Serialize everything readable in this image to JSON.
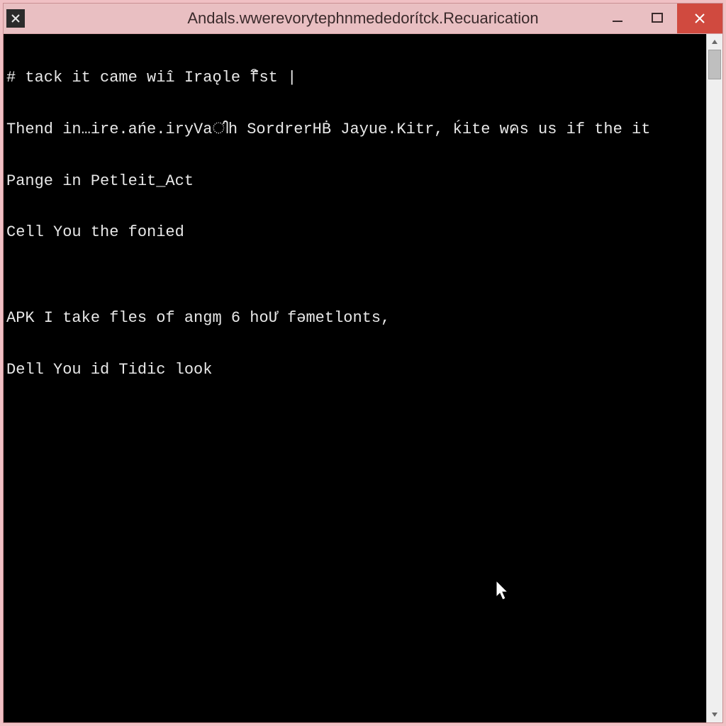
{
  "window": {
    "title": "Andals.wwerevorytephnmededorítck.Recuarication"
  },
  "terminal": {
    "lines": [
      "# tack it came wiî Iraǫle fิst |",
      "Thend in…ire.ańe.iryVaിh SordrerHḂ Jayue.Kitr, ḱite wคs us if the it",
      "Pange in Petleit_Act",
      "Cell You the fonied",
      "",
      "APK I take fles of angɱ 6 hoƯ fǝmetlonts,",
      "Dell You id Tidic look"
    ]
  },
  "colors": {
    "titlebar": "#e9bfc2",
    "close": "#d04a3f",
    "terminalBg": "#000000",
    "terminalFg": "#e8e8e8"
  }
}
